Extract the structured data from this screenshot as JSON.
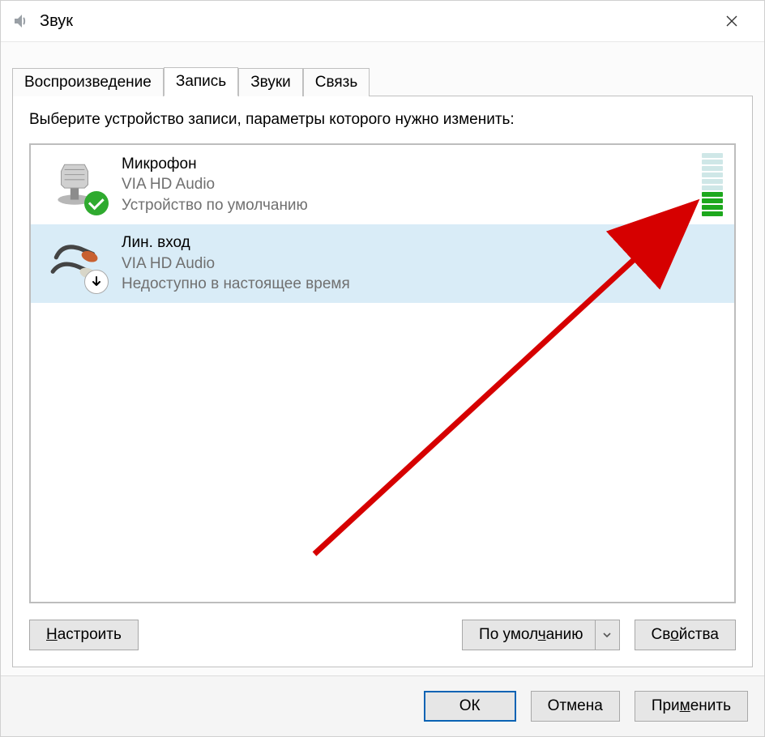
{
  "window": {
    "title": "Звук"
  },
  "tabs": {
    "items": [
      {
        "label": "Воспроизведение"
      },
      {
        "label": "Запись"
      },
      {
        "label": "Звуки"
      },
      {
        "label": "Связь"
      }
    ],
    "active_index": 1
  },
  "instruction": "Выберите устройство записи, параметры которого нужно изменить:",
  "devices": [
    {
      "name": "Микрофон",
      "desc": "VIA HD Audio",
      "status": "Устройство по умолчанию",
      "badge": "default",
      "icon": "microphone",
      "selected": false,
      "level_segments": 10,
      "level_active": 4
    },
    {
      "name": "Лин. вход",
      "desc": "VIA HD Audio",
      "status": "Недоступно в настоящее время",
      "badge": "down",
      "icon": "line-in",
      "selected": true,
      "level_segments": 0,
      "level_active": 0
    }
  ],
  "panel_buttons": {
    "configure": "Настроить",
    "default": "По умолчанию",
    "properties": "Свойства"
  },
  "bottom_buttons": {
    "ok": "ОК",
    "cancel": "Отмена",
    "apply": "Применить"
  }
}
